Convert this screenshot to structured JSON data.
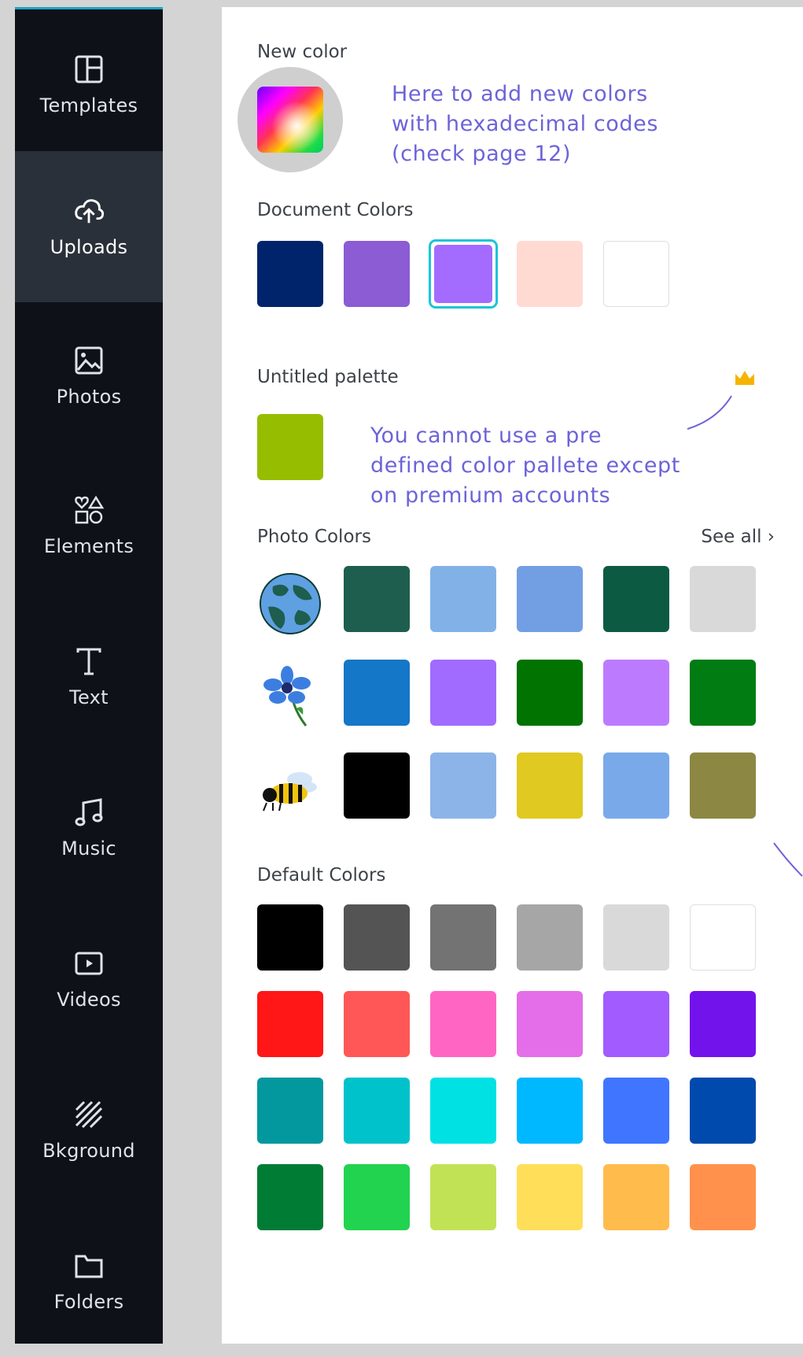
{
  "sidebar": {
    "items": [
      {
        "label": "Templates",
        "icon": "templates-icon"
      },
      {
        "label": "Uploads",
        "icon": "cloud-upload-icon"
      },
      {
        "label": "Photos",
        "icon": "photo-icon"
      },
      {
        "label": "Elements",
        "icon": "shapes-icon"
      },
      {
        "label": "Text",
        "icon": "text-icon"
      },
      {
        "label": "Music",
        "icon": "music-icon"
      },
      {
        "label": "Videos",
        "icon": "video-icon"
      },
      {
        "label": "Bkground",
        "icon": "background-icon"
      },
      {
        "label": "Folders",
        "icon": "folder-icon"
      }
    ],
    "active": "Uploads"
  },
  "panel": {
    "new_color_title": "New color",
    "new_color_annotation": [
      "Here to add new colors",
      "with hexadecimal codes",
      "(check page 12)"
    ],
    "document_colors_title": "Document Colors",
    "document_colors": [
      "#00246b",
      "#8b5cd4",
      "#a36cff",
      "#ffdad3",
      "#ffffff"
    ],
    "document_colors_selected_index": 2,
    "palette_title": "Untitled palette",
    "palette_colors": [
      "#96bd00"
    ],
    "palette_annotation": [
      "You cannot use a pre",
      "defined color pallete except",
      "on premium accounts"
    ],
    "photo_colors_title": "Photo Colors",
    "see_all_label": "See all",
    "photo_rows": [
      {
        "thumb": "earth-icon",
        "colors": [
          "#1e5e4e",
          "#82b1e8",
          "#729fe3",
          "#0c5a42",
          "#d9d9d9"
        ]
      },
      {
        "thumb": "flower-icon",
        "colors": [
          "#1477c8",
          "#a16bff",
          "#007300",
          "#bc7bff",
          "#007c12"
        ]
      },
      {
        "thumb": "bee-icon",
        "colors": [
          "#000000",
          "#8cb4e8",
          "#e0c920",
          "#7aa9ea",
          "#8c8843"
        ]
      }
    ],
    "default_colors_title": "Default Colors",
    "default_colors": [
      [
        "#000000",
        "#545454",
        "#737373",
        "#a6a6a6",
        "#d9d9d9",
        "#ffffff"
      ],
      [
        "#ff1616",
        "#ff5757",
        "#ff66c4",
        "#e46ee9",
        "#a15bff",
        "#7313eb"
      ],
      [
        "#03989e",
        "#00c2cb",
        "#00e1e4",
        "#00b8ff",
        "#4076ff",
        "#004aad"
      ],
      [
        "#007c35",
        "#22d34f",
        "#c2e256",
        "#ffde59",
        "#ffbc4d",
        "#ff914d"
      ]
    ]
  }
}
